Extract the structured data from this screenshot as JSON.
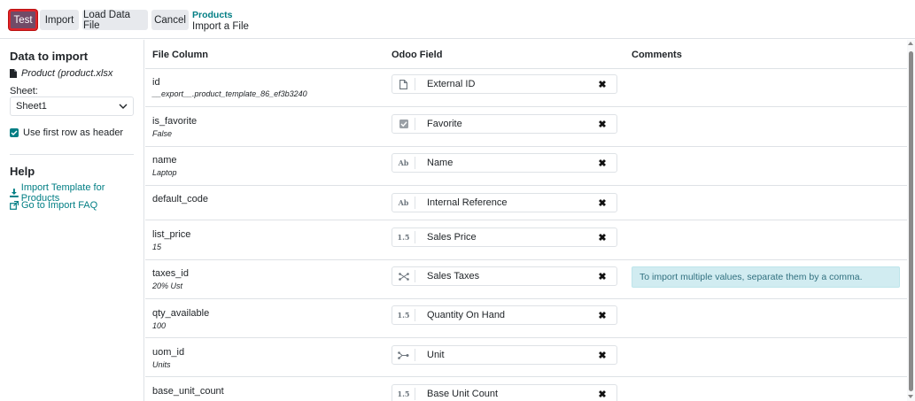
{
  "toolbar": {
    "test_label": "Test",
    "import_label": "Import",
    "load_label": "Load Data File",
    "cancel_label": "Cancel"
  },
  "breadcrumb": {
    "parent": "Products",
    "current": "Import a File"
  },
  "sidebar": {
    "data_title": "Data to import",
    "file_name": "Product (product.xlsx",
    "sheet_label": "Sheet:",
    "sheet_value": "Sheet1",
    "header_checkbox_label": "Use first row as header",
    "header_checked": true,
    "help_title": "Help",
    "template_link": "Import Template for Products",
    "faq_link": "Go to Import FAQ"
  },
  "table": {
    "headers": {
      "file_column": "File Column",
      "odoo_field": "Odoo Field",
      "comments": "Comments"
    },
    "rows": [
      {
        "name": "id",
        "sample": "__export__.product_template_86_ef3b3240",
        "field": "External ID",
        "icon": "file-icon",
        "comment": ""
      },
      {
        "name": "is_favorite",
        "sample": "False",
        "field": "Favorite",
        "icon": "checkbox-icon",
        "comment": ""
      },
      {
        "name": "name",
        "sample": "Laptop",
        "field": "Name",
        "icon": "text-icon",
        "comment": ""
      },
      {
        "name": "default_code",
        "sample": "",
        "field": "Internal Reference",
        "icon": "text-icon",
        "comment": ""
      },
      {
        "name": "list_price",
        "sample": "15",
        "field": "Sales Price",
        "icon": "float-icon",
        "comment": ""
      },
      {
        "name": "taxes_id",
        "sample": "20% Ust",
        "field": "Sales Taxes",
        "icon": "many2many-icon",
        "comment": "To import multiple values, separate them by a comma."
      },
      {
        "name": "qty_available",
        "sample": "100",
        "field": "Quantity On Hand",
        "icon": "float-icon",
        "comment": ""
      },
      {
        "name": "uom_id",
        "sample": "Units",
        "field": "Unit",
        "icon": "many2one-icon",
        "comment": ""
      },
      {
        "name": "base_unit_count",
        "sample": "",
        "field": "Base Unit Count",
        "icon": "float-icon",
        "comment": ""
      }
    ]
  },
  "icons": {
    "text-icon": "Ab",
    "float-icon": "1.5"
  },
  "colors": {
    "primary": "#714b67",
    "link": "#017e84",
    "info_bg": "#d1ecf1"
  }
}
